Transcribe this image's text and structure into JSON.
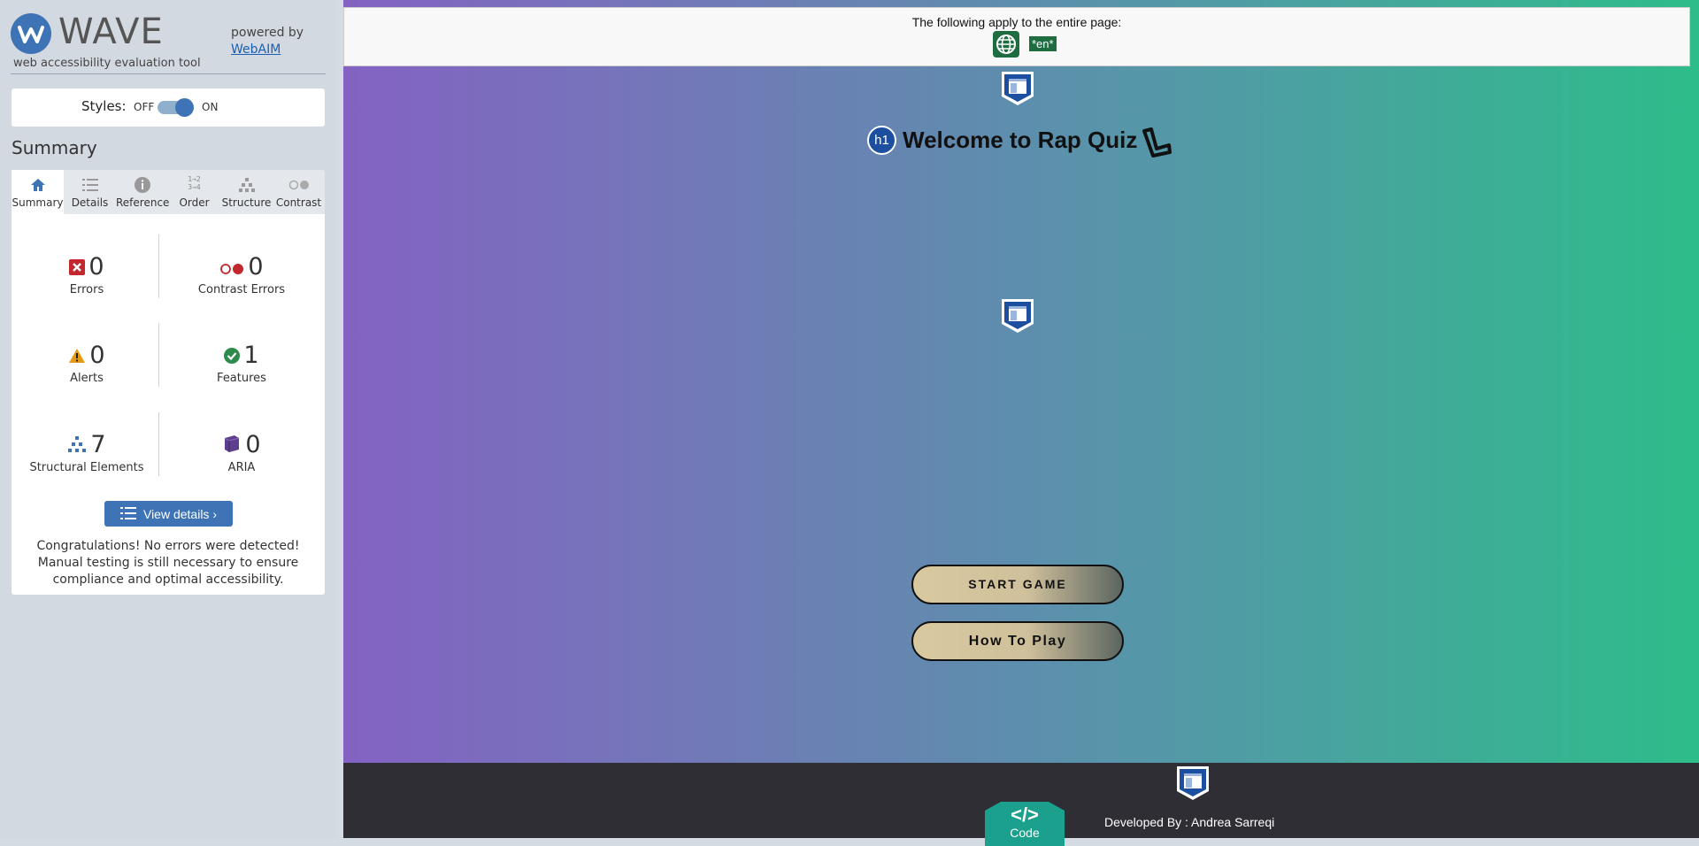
{
  "sidebar": {
    "logo_word": "WAVE",
    "tagline": "web accessibility evaluation tool",
    "powered_by": "powered by",
    "webaim_link": "WebAIM",
    "styles_label": "Styles:",
    "styles_off": "OFF",
    "styles_on": "ON",
    "styles_state": "on",
    "summary_heading": "Summary",
    "tabs": [
      {
        "label": "Summary",
        "icon": "home-icon",
        "active": true
      },
      {
        "label": "Details",
        "icon": "list-icon"
      },
      {
        "label": "Reference",
        "icon": "info-icon"
      },
      {
        "label": "Order",
        "icon": "order-icon"
      },
      {
        "label": "Structure",
        "icon": "structure-icon"
      },
      {
        "label": "Contrast",
        "icon": "contrast-icon"
      }
    ],
    "stats": {
      "errors": {
        "count": "0",
        "label": "Errors",
        "icon": "error-icon"
      },
      "contrast_errors": {
        "count": "0",
        "label": "Contrast Errors",
        "icon": "contrast-error-icon"
      },
      "alerts": {
        "count": "0",
        "label": "Alerts",
        "icon": "alert-icon"
      },
      "features": {
        "count": "1",
        "label": "Features",
        "icon": "feature-check-icon"
      },
      "structural": {
        "count": "7",
        "label": "Structural Elements",
        "icon": "structure-icon"
      },
      "aria": {
        "count": "0",
        "label": "ARIA",
        "icon": "aria-cube-icon"
      }
    },
    "view_details": "View details ›",
    "congrats": "Congratulations! No errors were detected! Manual testing is still necessary to ensure compliance and optimal accessibility."
  },
  "page": {
    "apply_text": "The following apply to the entire page:",
    "lang_badge": "*en*",
    "h1_badge": "h1",
    "title": "Welcome to Rap Quiz",
    "start_button": "START GAME",
    "how_to_play_button": "How To Play",
    "code_glyph": "</>",
    "code_label": "Code",
    "developed_by": "Developed By : Andrea Sarreqi"
  },
  "colors": {
    "wave_blue": "#3e74b5",
    "error_red": "#c1272d",
    "alert_orange": "#e39a17",
    "feature_green": "#2f8a4e",
    "aria_purple": "#5d3f8c",
    "footer_bg": "#2f2e34",
    "code_teal": "#1aa08c"
  }
}
